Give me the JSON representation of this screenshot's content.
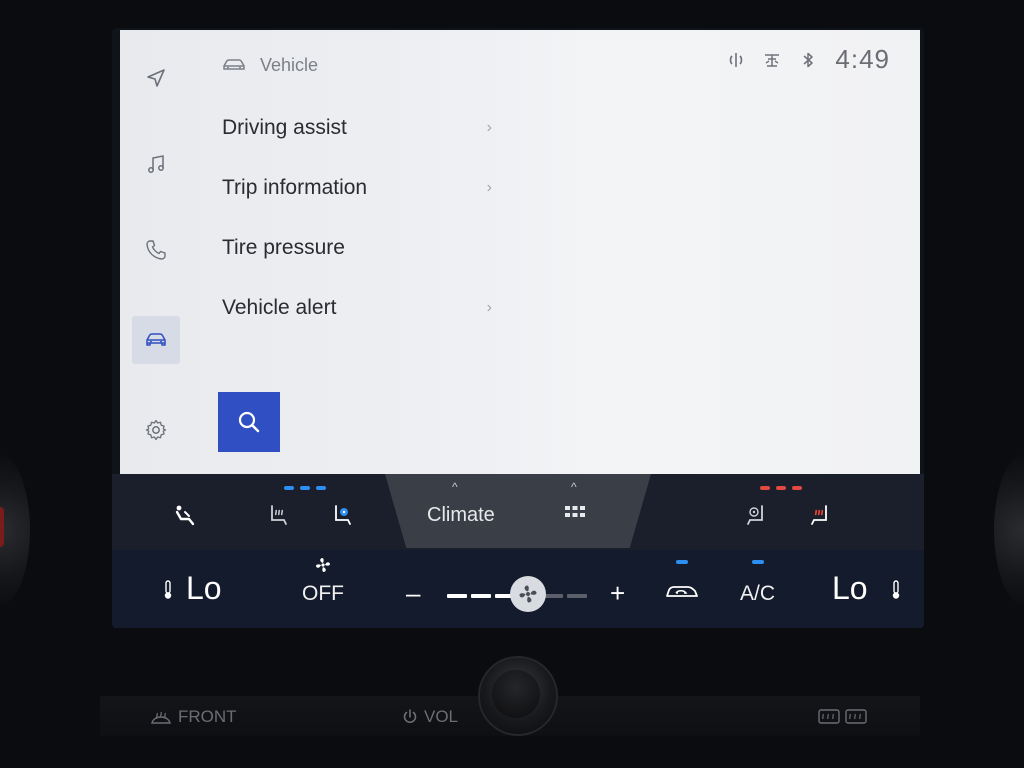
{
  "header": {
    "title": "Vehicle"
  },
  "status": {
    "time": "4:49"
  },
  "menu": {
    "items": [
      {
        "label": "Driving assist",
        "has_chevron": true
      },
      {
        "label": "Trip information",
        "has_chevron": true
      },
      {
        "label": "Tire pressure",
        "has_chevron": false
      },
      {
        "label": "Vehicle alert",
        "has_chevron": true
      }
    ],
    "chevron": "›"
  },
  "rail": {
    "items": [
      "navigation-icon",
      "music-icon",
      "phone-icon",
      "vehicle-icon",
      "settings-icon"
    ],
    "active": "vehicle-icon"
  },
  "climate": {
    "tab_label": "Climate",
    "caret": "^",
    "left_temp": "Lo",
    "right_temp": "Lo",
    "fan_label": "OFF",
    "ac_label": "A/C",
    "minus": "–",
    "plus": "+",
    "fan_level": 3,
    "fan_max": 6
  },
  "hardware": {
    "front_label": "FRONT",
    "vol_label": "VOL"
  },
  "colors": {
    "accent_blue": "#2f4fc3",
    "cool_indicator": "#2d8ff0",
    "heat_indicator": "#e2483d",
    "seat_heat_red": "#e8432f"
  }
}
